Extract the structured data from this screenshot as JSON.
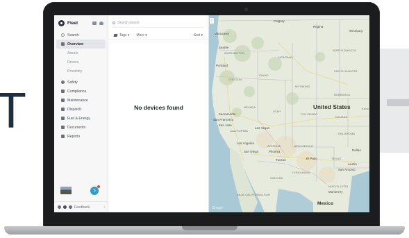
{
  "background": {
    "big_letter": "T"
  },
  "app": {
    "name": "Fleet"
  },
  "sidebar": {
    "search_label": "Search",
    "items": [
      {
        "label": "Overview",
        "icon": "truck-icon",
        "active": true
      },
      {
        "label": "Assets",
        "sub": true
      },
      {
        "label": "Drivers",
        "sub": true
      },
      {
        "label": "Proximity",
        "sub": true
      },
      {
        "label": "Safety",
        "icon": "shield-icon"
      },
      {
        "label": "Compliance",
        "icon": "clipboard-icon"
      },
      {
        "label": "Maintenance",
        "icon": "wrench-icon"
      },
      {
        "label": "Dispatch",
        "icon": "dispatch-icon"
      },
      {
        "label": "Fuel & Energy",
        "icon": "fuel-icon"
      },
      {
        "label": "Documents",
        "icon": "document-icon"
      },
      {
        "label": "Reports",
        "icon": "chart-icon"
      }
    ],
    "feedback_label": "Feedback",
    "avatar_initial": "S"
  },
  "list": {
    "search_placeholder": "Search assets",
    "filter_tags": "Tags",
    "filter_more": "More",
    "sort": "Sort",
    "empty_message": "No devices found"
  },
  "map": {
    "watermark": "Google",
    "labels": {
      "calgary": "Calgary",
      "regina": "Regina",
      "winnipeg": "Winnipeg",
      "vancouver": "Vancouver",
      "seattle": "Seattle",
      "washington": "WASHINGTON",
      "montana": "MONTANA",
      "north_dakota": "NORTH DAKOTA",
      "portland": "Portland",
      "oregon": "OREGON",
      "idaho": "IDAHO",
      "south_dakota": "SOUTH DAKOTA",
      "wyoming": "WYOMING",
      "nevada": "NEVADA",
      "sacramento": "Sacramento",
      "san_francisco": "San Francisco",
      "san_jose": "San Jose",
      "california": "CALIFORNIA",
      "utah": "UTAH",
      "colorado": "COLORADO",
      "nebraska": "NEBRASKA",
      "united_states": "United States",
      "kansas": "KANSAS",
      "las_vegas": "Las Vegas",
      "los_angeles": "Los Angeles",
      "arizona": "ARIZONA",
      "new_mexico": "NEW MEXICO",
      "oklahoma": "OKLAHOMA",
      "san_diego": "San Diego",
      "phoenix": "Phoenix",
      "tucson": "Tucson",
      "el_paso": "El Paso",
      "dallas": "Dallas",
      "austin": "Austin",
      "texas": "TEXAS",
      "san_antonio": "San Antonio",
      "chihuahua": "CHIHUAHUA",
      "sonora": "SONORA",
      "nuevo_leon": "NUEVO LEÓN",
      "monterrey": "Monterrey",
      "mexico": "Mexico",
      "baja": "BAJA CALIFORNIA SUR",
      "kans": "Kans"
    }
  }
}
